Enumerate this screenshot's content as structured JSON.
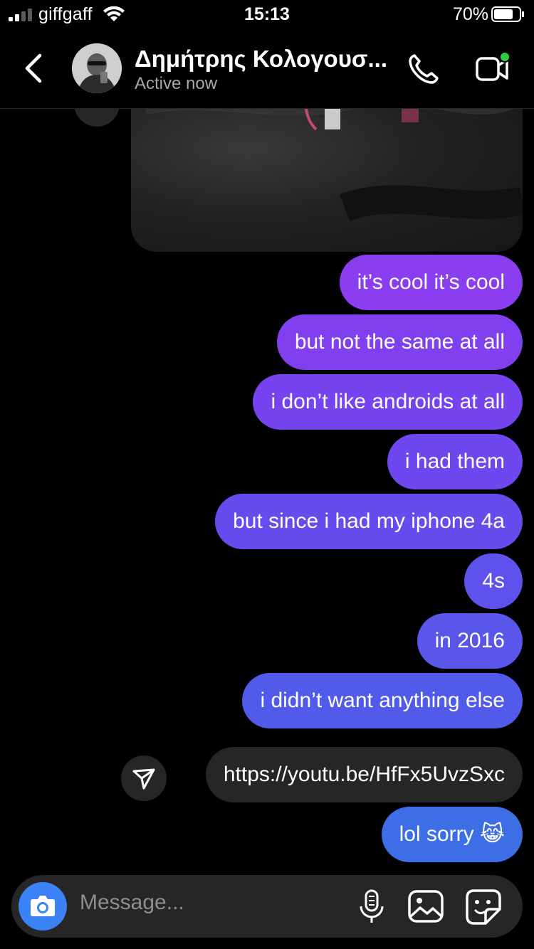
{
  "status_bar": {
    "carrier": "giffgaff",
    "time": "15:13",
    "battery": "70%"
  },
  "header": {
    "contact_name": "Δημήτρης Κολογουσ...",
    "contact_status": "Active now",
    "icons": [
      "back-chevron-icon",
      "avatar",
      "phone-icon",
      "video-camera-icon"
    ],
    "video_active_dot_color": "#2ecc40"
  },
  "messages": [
    {
      "text": "it’s cool it’s cool",
      "color": "#8a3ef0"
    },
    {
      "text": "but not the same at all",
      "color": "#8040f0"
    },
    {
      "text": "i don’t like androids at all",
      "color": "#7544ef"
    },
    {
      "text": "i had them",
      "color": "#6e47ee"
    },
    {
      "text": "but since i had my iphone 4a",
      "color": "#664ced"
    },
    {
      "text": "4s",
      "color": "#5f52ec"
    },
    {
      "text": "in 2016",
      "color": "#5a56ea"
    },
    {
      "text": "i didn’t want anything else",
      "color": "#525be9"
    },
    {
      "text": "https://youtu.be/HfFx5UvzSxc",
      "color": "#262626"
    },
    {
      "text": "lol sorry 😹",
      "color": "#3d6ee6"
    }
  ],
  "composer": {
    "placeholder": "Message...",
    "camera_color": "#3b82f6"
  }
}
